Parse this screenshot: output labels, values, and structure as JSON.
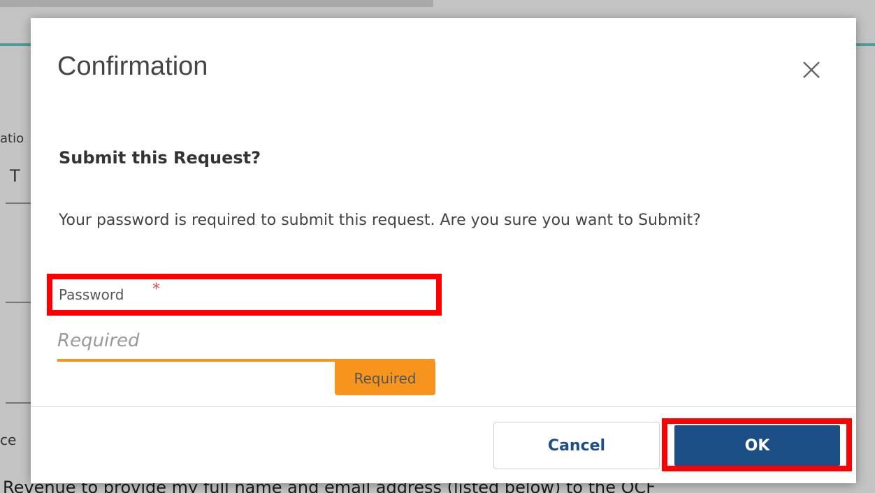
{
  "background": {
    "partial_label": "atio",
    "partial_field_value": "T",
    "partial_label_2": "ce",
    "bottom_text": "Revenue to provide my full name and email address (listed below) to the OCF"
  },
  "modal": {
    "title": "Confirmation",
    "close_icon": "close-icon",
    "subheading": "Submit this Request?",
    "message": "Your password is required to submit this request. Are you sure you want to Submit?",
    "password": {
      "label": "Password",
      "required_marker": "*",
      "placeholder": "Required",
      "value": "",
      "validation_badge": "Required"
    },
    "buttons": {
      "cancel": "Cancel",
      "ok": "OK"
    }
  },
  "colors": {
    "accent_orange": "#f7941d",
    "primary_blue": "#1b4e85",
    "highlight_red": "#ff0000",
    "teal": "#4f9c9c"
  }
}
